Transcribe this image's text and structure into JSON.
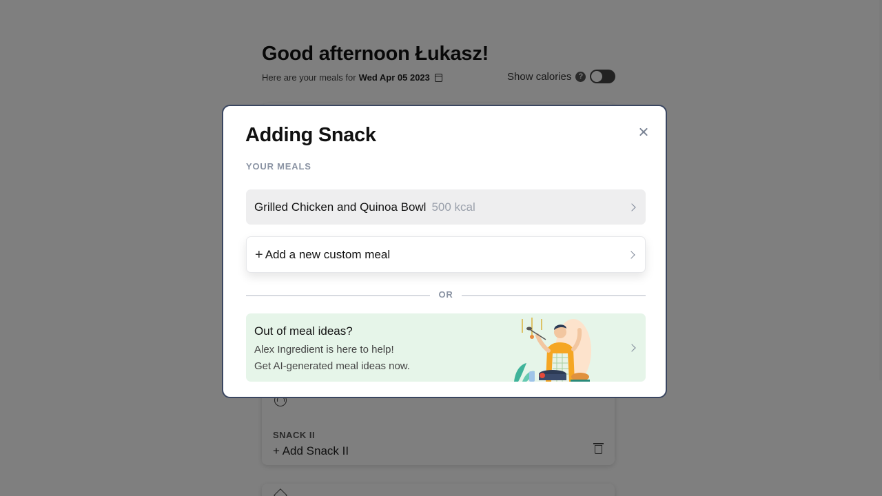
{
  "page": {
    "greeting": "Good afternoon Łukasz!",
    "subline_prefix": "Here are your meals for",
    "date": "Wed Apr 05 2023",
    "show_calories_label": "Show calories",
    "help_glyph": "?",
    "snack2_label": "SNACK II",
    "snack2_add": "+ Add Snack II"
  },
  "modal": {
    "title": "Adding Snack",
    "section_label": "YOUR MEALS",
    "meals": [
      {
        "name": "Grilled Chicken and Quinoa Bowl",
        "kcal": "500 kcal"
      }
    ],
    "custom_plus": "+",
    "custom_label": "Add a new custom meal",
    "divider_text": "OR",
    "ideas": {
      "title": "Out of meal ideas?",
      "line1": "Alex Ingredient is here to help!",
      "line2": "Get AI-generated meal ideas now."
    }
  },
  "colors": {
    "overlay": "rgba(0,0,0,0.5)",
    "modal_border": "#3a4660",
    "meal_row_bg": "#eeeeef",
    "ideas_bg": "#e6f5e9",
    "muted_text": "#8a93a3"
  },
  "icons": [
    "calendar-icon",
    "help-icon",
    "toggle",
    "close-icon",
    "chevron-right-icon",
    "trash-icon",
    "chef-illustration"
  ]
}
